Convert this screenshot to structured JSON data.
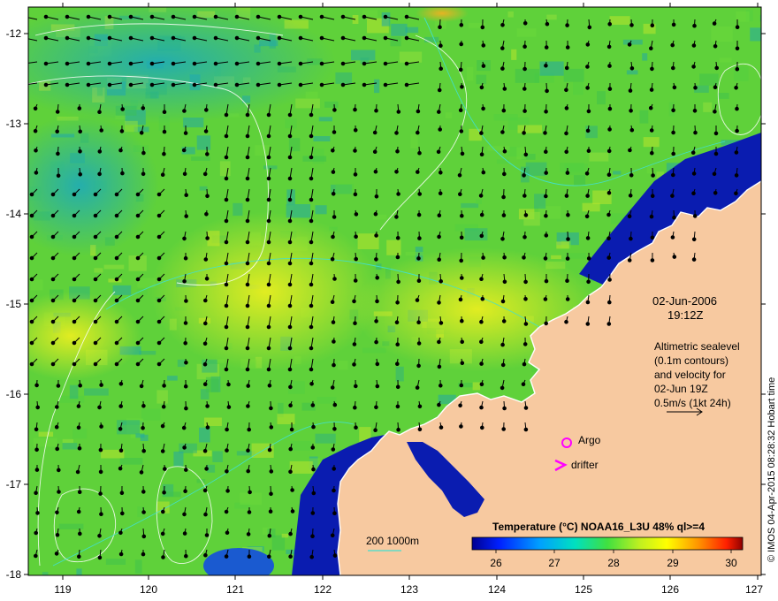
{
  "map": {
    "date_line": "02-Jun-2006",
    "time_line": "19:12Z",
    "altimetry_lines": [
      "Altimetric sealevel",
      "(0.1m contours)",
      "and velocity for",
      "02-Jun 19Z",
      "0.5m/s (1kt 24h)"
    ],
    "argo_label": "Argo",
    "drifter_label": "drifter",
    "bathy_label": "200  1000m",
    "credit": "© IMOS 04-Apr-2015 08:28:32 Hobart time",
    "colorbar_title": "Temperature (°C) NOAA16_L3U 48% ql>=4",
    "colorbar_ticks": [
      "26",
      "27",
      "28",
      "29",
      "30"
    ],
    "x_ticks": [
      "119",
      "120",
      "121",
      "122",
      "123",
      "124",
      "125",
      "126",
      "127"
    ],
    "y_ticks": [
      "-12",
      "-13",
      "-14",
      "-15",
      "-16",
      "-17",
      "-18"
    ],
    "colors": {
      "land": "#f7c9a0",
      "sea_mid": "#5fd13a",
      "sea_warm": "#cfe829",
      "sea_cool": "#19b6a6",
      "coast_cold": "#0a1cb0",
      "argo": "#ff00ff",
      "drifter": "#ff00ff",
      "contour": "#ffffff",
      "bathy": "#40e0d0"
    }
  }
}
